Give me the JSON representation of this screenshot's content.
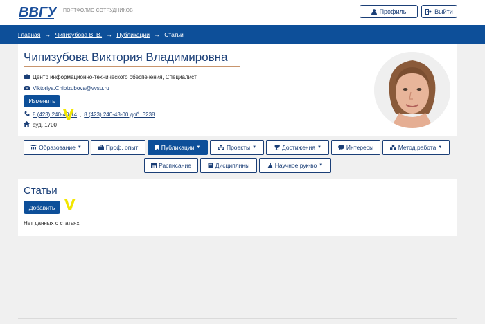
{
  "header": {
    "logo_text": "ВВГУ",
    "tagline": "ПОРТФОЛИО СОТРУДНИКОВ",
    "profile_label": "Профиль",
    "exit_label": "Выйти"
  },
  "breadcrumb": {
    "items": [
      "Главная",
      "Чипизубова В. В.",
      "Публикации",
      "Статьи"
    ],
    "separator": "→"
  },
  "profile": {
    "name": "Чипизубова Виктория Владимировна",
    "position": "Центр информационно-технического обеспечения, Специалист",
    "email": "Viktoriya.Chipizubova@vvsu.ru",
    "edit_label": "Изменить",
    "phone_1": "8 (423) 240-40-14",
    "phone_sep": ",",
    "phone_2": "8 (423) 240-43-00 доб. 3238",
    "room": "ауд. 1700"
  },
  "tabs": {
    "row1": [
      {
        "label": "Образование",
        "icon": "university-icon",
        "dropdown": true
      },
      {
        "label": "Проф. опыт",
        "icon": "briefcase-icon",
        "dropdown": false
      },
      {
        "label": "Публикации",
        "icon": "bookmark-icon",
        "dropdown": true,
        "active": true
      },
      {
        "label": "Проекты",
        "icon": "sitemap-icon",
        "dropdown": true
      },
      {
        "label": "Достижения",
        "icon": "trophy-icon",
        "dropdown": true
      },
      {
        "label": "Интересы",
        "icon": "comment-icon",
        "dropdown": false
      },
      {
        "label": "Метод.работа",
        "icon": "cubes-icon",
        "dropdown": true
      }
    ],
    "row2": [
      {
        "label": "Расписание",
        "icon": "calendar-icon",
        "dropdown": false
      },
      {
        "label": "Дисциплины",
        "icon": "book-icon",
        "dropdown": false
      },
      {
        "label": "Научное рук-во",
        "icon": "flask-icon",
        "dropdown": true
      }
    ]
  },
  "articles": {
    "title": "Статьи",
    "add_label": "Добавить",
    "empty_text": "Нет данных о статьях"
  },
  "annotations": {
    "mark_1": "V",
    "mark_2": "V"
  },
  "colors": {
    "primary": "#0d4f99",
    "accent_line": "#c8956d",
    "annotation": "#f2e600"
  }
}
